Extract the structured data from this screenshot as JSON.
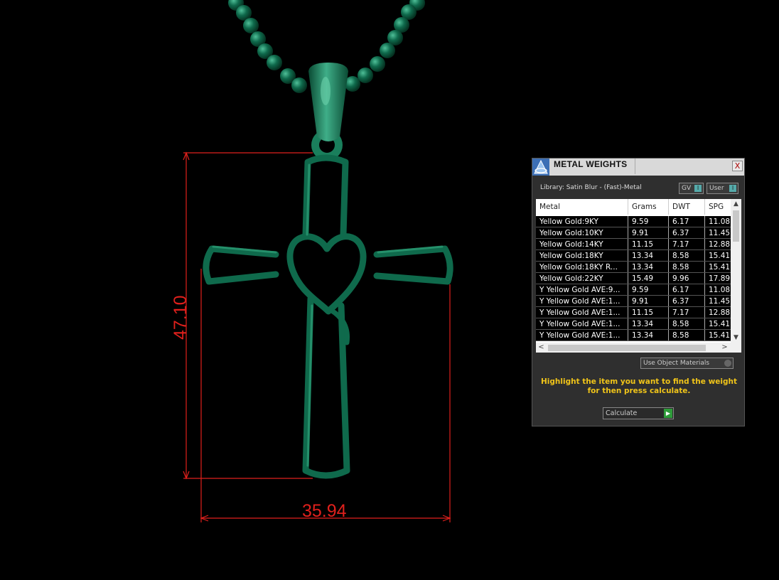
{
  "dimensions": {
    "height_label": "47.10",
    "width_label": "35.94"
  },
  "panel": {
    "title": "METAL WEIGHTS",
    "close_label": "X",
    "library_label": "Library: Satin Blur - (Fast)-Metal",
    "gv_label": "GV",
    "user_label": "User",
    "use_object_materials_label": "Use Object Materials",
    "hint_line1": "Highlight the item you want to find the weight",
    "hint_line2": "for then press calculate.",
    "calculate_label": "Calculate",
    "table": {
      "columns": [
        "Metal",
        "Grams",
        "DWT",
        "SPG"
      ],
      "rows": [
        [
          "Yellow Gold:9KY",
          "9.59",
          "6.17",
          "11.08"
        ],
        [
          "Yellow Gold:10KY",
          "9.91",
          "6.37",
          "11.45"
        ],
        [
          "Yellow Gold:14KY",
          "11.15",
          "7.17",
          "12.88"
        ],
        [
          "Yellow Gold:18KY",
          "13.34",
          "8.58",
          "15.41"
        ],
        [
          "Yellow Gold:18KY R...",
          "13.34",
          "8.58",
          "15.41"
        ],
        [
          "Yellow Gold:22KY",
          "15.49",
          "9.96",
          "17.89"
        ],
        [
          "Y Yellow Gold AVE:9...",
          "9.59",
          "6.17",
          "11.08"
        ],
        [
          "Y Yellow Gold AVE:1...",
          "9.91",
          "6.37",
          "11.45"
        ],
        [
          "Y Yellow Gold AVE:1...",
          "11.15",
          "7.17",
          "12.88"
        ],
        [
          "Y Yellow Gold AVE:1...",
          "13.34",
          "8.58",
          "15.41"
        ],
        [
          "Y Yellow Gold AVE:1...",
          "13.34",
          "8.58",
          "15.41"
        ]
      ]
    }
  },
  "colors": {
    "dimension": "#e0201c",
    "pendant": "#0f6a4c",
    "hint": "#f0c419"
  }
}
